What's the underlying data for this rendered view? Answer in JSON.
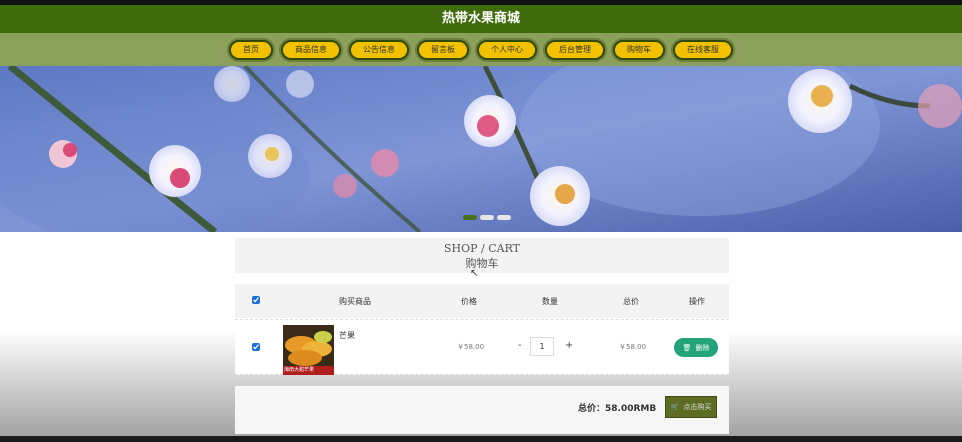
{
  "site_title": "热带水果商城",
  "nav": [
    "首页",
    "商品信息",
    "公告信息",
    "留言板",
    "个人中心",
    "后台管理",
    "购物车",
    "在线客服"
  ],
  "cart_header": {
    "en": "SHOP / CART",
    "cn": "购物车"
  },
  "table_headers": {
    "product": "购买商品",
    "price": "价格",
    "qty": "数量",
    "total": "总价",
    "action": "操作"
  },
  "items": [
    {
      "name": "芒果",
      "price": "￥58.00",
      "qty": "1",
      "total": "￥58.00",
      "delete_label": "删除",
      "img_caption": "海南大甜芒果"
    }
  ],
  "qty_minus": "-",
  "qty_plus": "+",
  "summary": {
    "total_text": "总价：58.00RMB",
    "buy_label": "点击购买"
  },
  "colors": {
    "titlebar": "#3f6b0c",
    "navbar": "#8aa05b",
    "nav_item": "#f2c200",
    "delete": "#22a37a",
    "buy": "#5d6b23"
  }
}
